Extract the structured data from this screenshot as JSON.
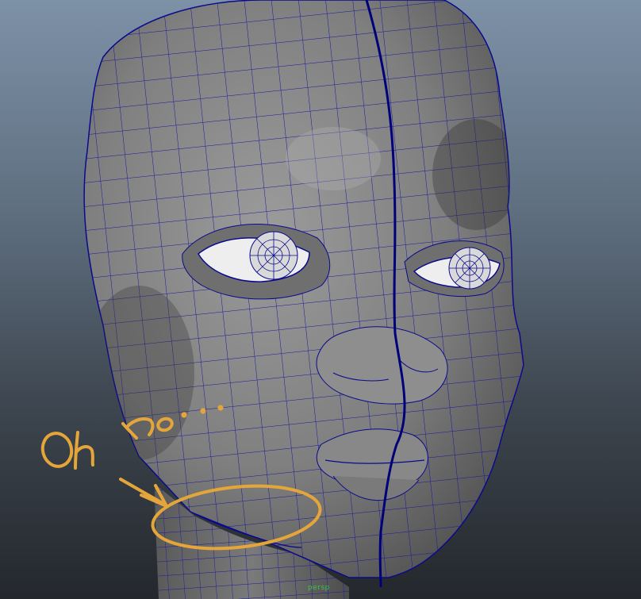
{
  "viewport": {
    "camera_label": "persp",
    "background_top": "#7d91a7",
    "background_bottom": "#24282d"
  },
  "model": {
    "surface_color": "#8a8a8a",
    "wire_color": "#0a0a8c",
    "seam_color": "#00007a"
  },
  "annotation": {
    "text": "Oh No...",
    "stroke_color": "#e4a63a"
  }
}
